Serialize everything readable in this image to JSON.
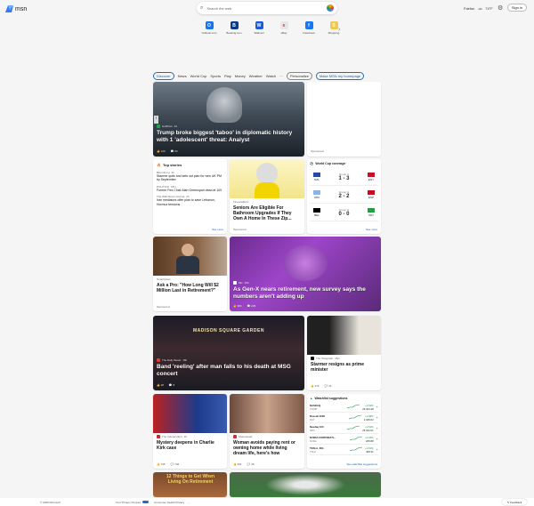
{
  "header": {
    "logo": "msn",
    "search_placeholder": "Search the web",
    "location": "Fairfax",
    "temperature": "74°F",
    "signin": "Sign in"
  },
  "tiles": [
    {
      "label": "Outlook.com",
      "color": "#1a73e8",
      "glyph": "O"
    },
    {
      "label": "Booking.com",
      "color": "#0a3a8c",
      "glyph": "B"
    },
    {
      "label": "Walmart",
      "color": "#1a5bd6",
      "glyph": "W"
    },
    {
      "label": "eBay",
      "color": "#e7e7e7",
      "glyph": "e"
    },
    {
      "label": "Facebook",
      "color": "#1877f2",
      "glyph": "f"
    },
    {
      "label": "Shopping",
      "color": "#f2c94c",
      "glyph": "S"
    }
  ],
  "nav": {
    "tabs": [
      "Discover",
      "News",
      "World Cup",
      "Sports",
      "Play",
      "Money",
      "Weather",
      "Watch"
    ],
    "more": "···",
    "personalize": "Personalize",
    "homepage": "Make MSN my homepage"
  },
  "hero": {
    "source": "HuffPost",
    "time": "4d",
    "title": "Trump broke biggest 'taboo' in diplomatic history with 1 'adolescent' threat: Analyst",
    "likes": "149",
    "comments": "80"
  },
  "ad_top": {
    "sponsored": "Sponsored"
  },
  "top_stories": {
    "heading": "Top stories",
    "see_more": "See more",
    "items": [
      {
        "source": "Bloomberg",
        "time": "2h",
        "title": "Starmer quits and sets out plan for new UK PM by September"
      },
      {
        "source": "POLITICO",
        "time": "18m",
        "title": "Former Fed Chair Alan Greenspan dead at 100"
      },
      {
        "source": "The Wall Street Journal",
        "time": "2h",
        "title": "Iran mediators offer plan to save Lebanon, Hormuz tensions"
      }
    ]
  },
  "seniors": {
    "source": "FinanceBuzz",
    "title": "Seniors Are Eligible For Bathroom Upgrades If They Own A Home In These Zip...",
    "sponsored": "Sponsored"
  },
  "worldcup": {
    "heading": "World Cup coverage",
    "see_more": "See more",
    "matches": [
      {
        "group": "Group C",
        "home": "NZL",
        "away": "EGY",
        "score": "1 - 3",
        "home_flag": "#2a4a9c",
        "away_flag": "#c8102e"
      },
      {
        "group": "Group G",
        "home": "URU",
        "away": "ESP",
        "score": "2 - 2",
        "home_flag": "#8ab4e8",
        "away_flag": "#c60b1e"
      },
      {
        "group": "Group G",
        "home": "BEL",
        "away": "IRN",
        "score": "0 - 0",
        "home_flag": "#000000",
        "away_flag": "#239f40"
      }
    ]
  },
  "finance_ad": {
    "source": "SmartAsset",
    "title": "Ask a Pro: \"How Long Will $2 Million Last in Retirement?\"",
    "sponsored": "Sponsored"
  },
  "genx": {
    "source": "Mic",
    "time": "10h",
    "title": "As Gen-X nears retirement, new survey says the numbers aren't adding up",
    "likes": "984",
    "comments": "229"
  },
  "msg": {
    "source": "The Daily Beast",
    "time": "16h",
    "title": "Band 'reeling' after man falls to his death at MSG concert",
    "likes": "28",
    "comments": "8",
    "marquee": "MADISON SQUARE GARDEN"
  },
  "starmer": {
    "source": "The Telegraph",
    "time": "16m",
    "title": "Starmer resigns as prime minister",
    "likes": "276",
    "comments": "31"
  },
  "kirk": {
    "source": "The Independent",
    "time": "4h",
    "title": "Mystery deepens in Charlie Kirk case",
    "likes": "735",
    "comments": "746"
  },
  "rent": {
    "source": "Glamsquad",
    "time": "",
    "title": "Woman avoids paying rent or owning home while living dream life, here's how",
    "likes": "401",
    "comments": "46"
  },
  "watchlist": {
    "heading": "Watchlist suggestions",
    "see_more": "See watchlist suggestions",
    "stocks": [
      {
        "sym": "NASDAQ",
        "name": "COMP",
        "price": "+1.61%",
        "sub": "26,024.48"
      },
      {
        "sym": "Russell 2000",
        "name": "RUT",
        "price": "+1.06%",
        "sub": "2,345.62"
      },
      {
        "sym": "Nasdaq 100",
        "name": "NDX",
        "price": "+1.51%",
        "sub": "25,912.01"
      },
      {
        "sym": "NVIDIA CORPORATI...",
        "name": "NVDA",
        "price": "+2.34%",
        "sub": "205.88"
      },
      {
        "sym": "TESLA, INC.",
        "name": "TSLA",
        "price": "+1.61%",
        "sub": "408.31"
      }
    ]
  },
  "bottom_ad": {
    "text": "12 Things to Get When Living On Retirement"
  },
  "footer": {
    "copyright": "© 2026 Microsoft",
    "privacy": "Your Privacy Choices",
    "consumer": "Consumer Health Privacy",
    "dots": "···",
    "feedback": "Feedback"
  }
}
